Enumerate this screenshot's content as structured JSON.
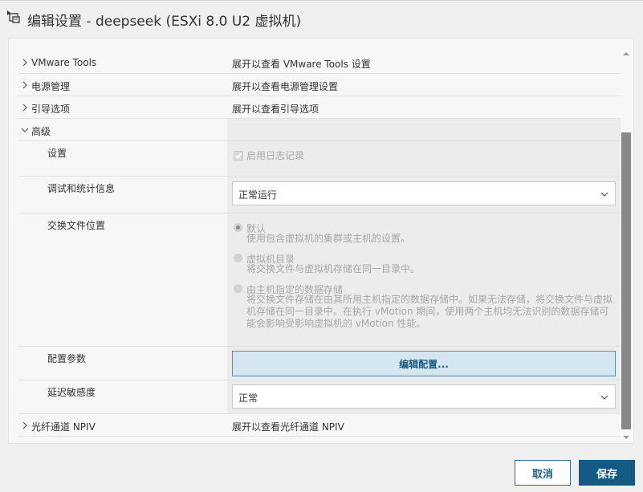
{
  "window": {
    "title": "编辑设置 - deepseek (ESXi 8.0 U2 虚拟机)"
  },
  "sections": {
    "vmware_tools": {
      "label": "VMware Tools",
      "value": "展开以查看 VMware Tools 设置"
    },
    "power": {
      "label": "电源管理",
      "value": "展开以查看电源管理设置"
    },
    "boot": {
      "label": "引导选项",
      "value": "展开以查看引导选项"
    },
    "advanced": {
      "label": "高级",
      "settings": {
        "label": "设置",
        "checkbox_label": "启用日志记录",
        "checked": true
      },
      "debug": {
        "label": "调试和统计信息",
        "selected": "正常运行"
      },
      "swap": {
        "label": "交换文件位置",
        "options": [
          {
            "title": "默认",
            "desc": "使用包含虚拟机的集群或主机的设置。",
            "checked": true
          },
          {
            "title": "虚拟机目录",
            "desc": "将交换文件与虚拟机存储在同一目录中。",
            "checked": false
          },
          {
            "title": "由主机指定的数据存储",
            "desc": "将交换文件存储在由其所用主机指定的数据存储中。如果无法存储，将交换文件与虚拟机存储在同一目录中。在执行 vMotion 期间，使用两个主机均无法识别的数据存储可能会影响受影响虚拟机的 vMotion 性能。",
            "checked": false
          }
        ]
      },
      "config": {
        "label": "配置参数",
        "button": "编辑配置..."
      },
      "latency": {
        "label": "延迟敏感度",
        "selected": "正常"
      }
    },
    "npiv": {
      "label": "光纤通道 NPIV",
      "value": "展开以查看光纤通道 NPIV"
    }
  },
  "footer": {
    "cancel": "取消",
    "save": "保存"
  },
  "colors": {
    "primary": "#155a85",
    "button_fill": "#d4e6f0"
  }
}
